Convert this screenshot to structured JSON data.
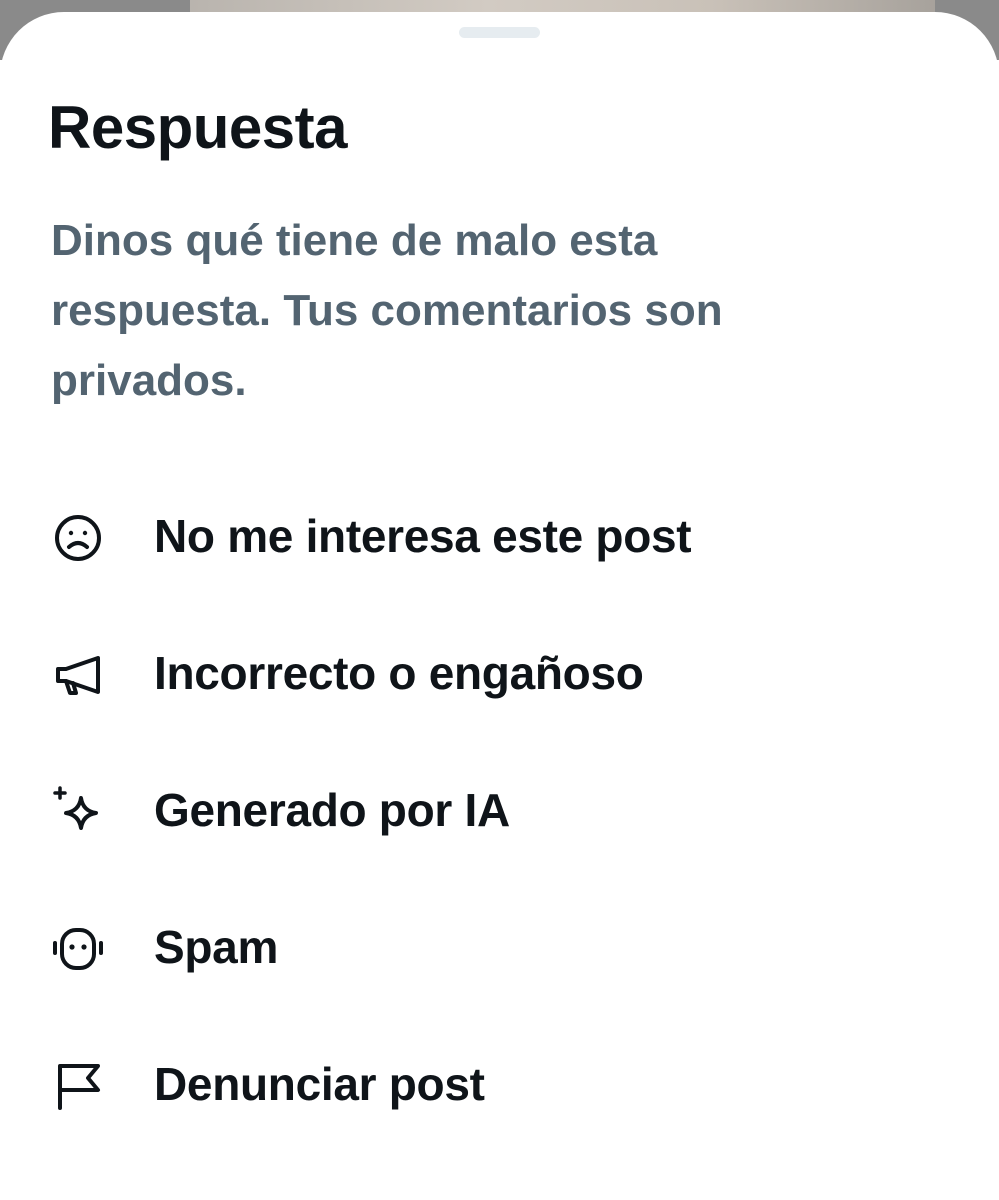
{
  "sheet": {
    "title": "Respuesta",
    "subtitle": "Dinos qué tiene de malo esta respuesta. Tus comentarios son privados."
  },
  "menu": {
    "items": [
      {
        "label": "No me interesa este post",
        "icon": "frown-face-icon"
      },
      {
        "label": "Incorrecto o engañoso",
        "icon": "megaphone-icon"
      },
      {
        "label": "Generado por IA",
        "icon": "sparkle-icon"
      },
      {
        "label": "Spam",
        "icon": "robot-icon"
      },
      {
        "label": "Denunciar post",
        "icon": "flag-icon"
      }
    ]
  },
  "colors": {
    "title": "#0f1419",
    "subtitle": "#536471",
    "grabber": "#e6ecf0",
    "background": "#ffffff"
  }
}
